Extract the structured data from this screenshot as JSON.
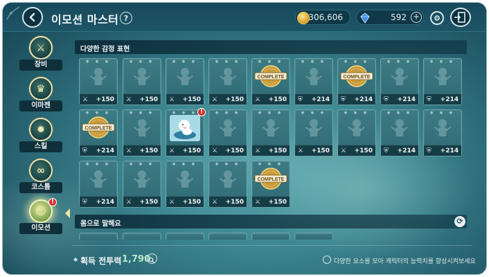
{
  "header": {
    "title": "이모션 마스터",
    "help_label": "?",
    "gold_amount": "306,606",
    "gem_amount": "592",
    "gem_add_label": "+"
  },
  "sidebar": {
    "items": [
      {
        "label": "장비",
        "icon": "equipment-icon",
        "active": false,
        "alert": false
      },
      {
        "label": "이마젠",
        "icon": "imagen-icon",
        "active": false,
        "alert": false
      },
      {
        "label": "스킬",
        "icon": "skill-icon",
        "active": false,
        "alert": false
      },
      {
        "label": "코스튬",
        "icon": "costume-icon",
        "active": false,
        "alert": false
      },
      {
        "label": "이모션",
        "icon": "emotion-icon",
        "active": true,
        "alert": true
      }
    ],
    "alert_mark": "!"
  },
  "sections": [
    {
      "title": "다양한 감정 표현"
    },
    {
      "title": "몸으로 말해요"
    }
  ],
  "complete_label": "COMPLETE",
  "cards": [
    {
      "stat_icon": "sword-icon",
      "value": "+150",
      "complete": false,
      "alert": false
    },
    {
      "stat_icon": "sword-icon",
      "value": "+150",
      "complete": false,
      "alert": false
    },
    {
      "stat_icon": "sword-icon",
      "value": "+150",
      "complete": false,
      "alert": false
    },
    {
      "stat_icon": "sword-icon",
      "value": "+150",
      "complete": false,
      "alert": false
    },
    {
      "stat_icon": "sword-icon",
      "value": "+150",
      "complete": true,
      "alert": false
    },
    {
      "stat_icon": "shield-icon",
      "value": "+214",
      "complete": false,
      "alert": false
    },
    {
      "stat_icon": "shield-icon",
      "value": "+214",
      "complete": true,
      "alert": false
    },
    {
      "stat_icon": "shield-icon",
      "value": "+214",
      "complete": false,
      "alert": false
    },
    {
      "stat_icon": "shield-icon",
      "value": "+214",
      "complete": false,
      "alert": false
    },
    {
      "stat_icon": "shield-icon",
      "value": "+214",
      "complete": true,
      "alert": false
    },
    {
      "stat_icon": "sword-icon",
      "value": "+150",
      "complete": false,
      "alert": false
    },
    {
      "stat_icon": "sword-icon",
      "value": "+150",
      "complete": false,
      "alert": true
    },
    {
      "stat_icon": "sword-icon",
      "value": "+150",
      "complete": false,
      "alert": false
    },
    {
      "stat_icon": "sword-icon",
      "value": "+150",
      "complete": false,
      "alert": false
    },
    {
      "stat_icon": "sword-icon",
      "value": "+150",
      "complete": false,
      "alert": false
    },
    {
      "stat_icon": "sword-icon",
      "value": "+150",
      "complete": false,
      "alert": false
    },
    {
      "stat_icon": "shield-icon",
      "value": "+214",
      "complete": false,
      "alert": false
    },
    {
      "stat_icon": "shield-icon",
      "value": "+214",
      "complete": false,
      "alert": false
    },
    {
      "stat_icon": "shield-icon",
      "value": "+214",
      "complete": false,
      "alert": false
    },
    {
      "stat_icon": "sword-icon",
      "value": "+150",
      "complete": false,
      "alert": false
    },
    {
      "stat_icon": "sword-icon",
      "value": "+150",
      "complete": false,
      "alert": false
    },
    {
      "stat_icon": "sword-icon",
      "value": "+150",
      "complete": false,
      "alert": false
    },
    {
      "stat_icon": "sword-icon",
      "value": "+150",
      "complete": true,
      "alert": false
    }
  ],
  "footer": {
    "power_label": "획득 전투력",
    "power_value": "1,790",
    "tip_text": "다양한 요소를 모아 캐릭터의 능력치를 향상시켜보세요"
  },
  "colors": {
    "background": "#3d8791",
    "topbar": "#17495c",
    "card": "#3d7b84",
    "alert": "#d22b2b",
    "power_value": "#b8e8c8"
  }
}
